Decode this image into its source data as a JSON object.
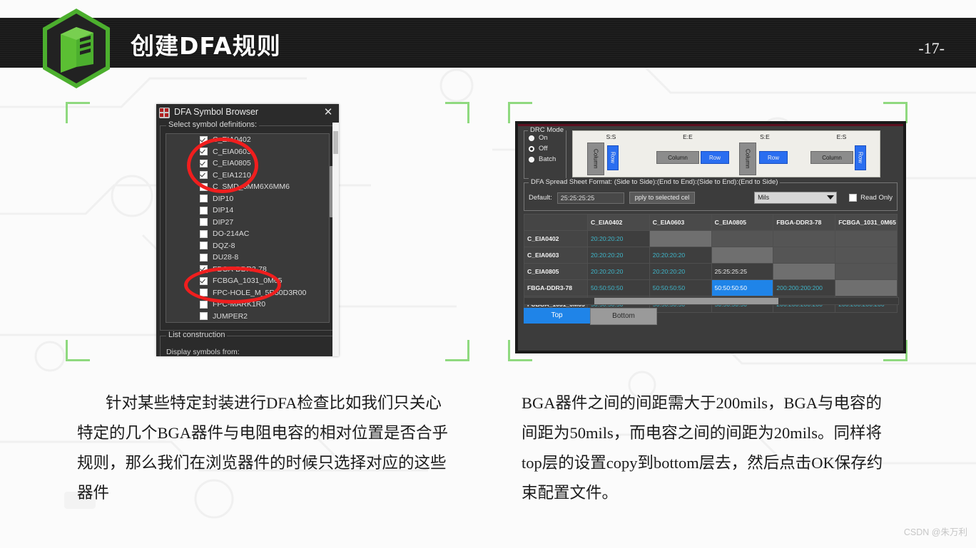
{
  "header": {
    "title": "创建DFA规则",
    "page_number": "-17-",
    "logo_icon": "cube-hexagon-logo",
    "band_color": "#191919",
    "accent_color": "#4CAF2E"
  },
  "bracket_color": "#8fd97f",
  "left_dialog": {
    "window_title": "DFA Symbol Browser",
    "app_icon": "dfa-symbol-icon",
    "close_icon": "close-icon",
    "group_label": "Select symbol definitions:",
    "symbols": [
      {
        "label": "C_EIA0402",
        "checked": true
      },
      {
        "label": "C_EIA0603",
        "checked": true
      },
      {
        "label": "C_EIA0805",
        "checked": true
      },
      {
        "label": "C_EIA1210",
        "checked": true
      },
      {
        "label": "C_SMD_6MM6X6MM6",
        "checked": false
      },
      {
        "label": "DIP10",
        "checked": false
      },
      {
        "label": "DIP14",
        "checked": false
      },
      {
        "label": "DIP27",
        "checked": false
      },
      {
        "label": "DO-214AC",
        "checked": false
      },
      {
        "label": "DQZ-8",
        "checked": false
      },
      {
        "label": "DU28-8",
        "checked": false
      },
      {
        "label": "FBGA-DDR3-78",
        "checked": true
      },
      {
        "label": "FCBGA_1031_0M65",
        "checked": true
      },
      {
        "label": "FPC-HOLE_M_5R50D3R00",
        "checked": false
      },
      {
        "label": "FPC-MARK1R0",
        "checked": false
      },
      {
        "label": "JUMPER2",
        "checked": false
      }
    ],
    "group2_label": "List construction",
    "group2_sub": "Display symbols from:"
  },
  "right_dialog": {
    "drc_mode": {
      "label": "DRC Mode",
      "options": [
        {
          "label": "On",
          "selected": false
        },
        {
          "label": "Off",
          "selected": true
        },
        {
          "label": "Batch",
          "selected": false
        }
      ]
    },
    "corner_panel": {
      "groups": [
        {
          "title": "S:S",
          "column_label": "Column",
          "row_label": "Row",
          "orientation": "col-vert-row-vert"
        },
        {
          "title": "E:E",
          "column_label": "Column",
          "row_label": "Row",
          "orientation": "col-horiz-row-horiz"
        },
        {
          "title": "S:E",
          "column_label": "Column",
          "row_label": "Row",
          "orientation": "col-vert-row-horiz"
        },
        {
          "title": "E:S",
          "column_label": "Column",
          "row_label": "Row",
          "orientation": "col-horiz-row-vert"
        }
      ]
    },
    "format_group": {
      "label": "DFA Spread Sheet Format: (Side to Side):(End to End):(Side to End):(End to Side)",
      "default_label": "Default:",
      "default_value": "25:25:25:25",
      "apply_button": "pply to selected cel",
      "units_value": "Mils",
      "units_icon": "chevron-down-icon",
      "read_only_label": "Read Only",
      "read_only_checked": false
    },
    "grid": {
      "columns": [
        "",
        "C_EIA0402",
        "C_EIA0603",
        "C_EIA0805",
        "FBGA-DDR3-78",
        "FCBGA_1031_0M65"
      ],
      "rows": [
        {
          "header": "C_EIA0402",
          "cells": [
            {
              "text": "20:20:20:20",
              "state": "value"
            },
            {
              "text": "",
              "state": "empty"
            },
            {
              "text": "",
              "state": "empty"
            },
            {
              "text": "",
              "state": "empty"
            },
            {
              "text": "",
              "state": "empty"
            }
          ]
        },
        {
          "header": "C_EIA0603",
          "cells": [
            {
              "text": "20:20:20:20",
              "state": "value"
            },
            {
              "text": "20:20:20:20",
              "state": "value"
            },
            {
              "text": "",
              "state": "empty"
            },
            {
              "text": "",
              "state": "empty"
            },
            {
              "text": "",
              "state": "empty"
            }
          ]
        },
        {
          "header": "C_EIA0805",
          "cells": [
            {
              "text": "20:20:20:20",
              "state": "value"
            },
            {
              "text": "20:20:20:20",
              "state": "value"
            },
            {
              "text": "25:25:25:25",
              "state": "value-white"
            },
            {
              "text": "",
              "state": "empty"
            },
            {
              "text": "",
              "state": "empty"
            }
          ]
        },
        {
          "header": "FBGA-DDR3-78",
          "cells": [
            {
              "text": "50:50:50:50",
              "state": "value"
            },
            {
              "text": "50:50:50:50",
              "state": "value"
            },
            {
              "text": "50:50:50:50",
              "state": "selected"
            },
            {
              "text": "200:200:200:200",
              "state": "value"
            },
            {
              "text": "",
              "state": "empty"
            }
          ]
        },
        {
          "header": "FCBGA_1031_0M65",
          "cells": [
            {
              "text": "50:50:50:50",
              "state": "value"
            },
            {
              "text": "50:50:50:50",
              "state": "value"
            },
            {
              "text": "50:50:50:50",
              "state": "value"
            },
            {
              "text": "200:200:200:200",
              "state": "value"
            },
            {
              "text": "200:200:200:200",
              "state": "value"
            }
          ]
        }
      ]
    },
    "tabs": [
      {
        "label": "Top",
        "active": true
      },
      {
        "label": "Bottom",
        "active": false
      }
    ],
    "selected_cell_color": "#1f84e8",
    "value_text_color": "#3fb5c9"
  },
  "body": {
    "paragraph_left": "针对某些特定封装进行DFA检查比如我们只关心特定的几个BGA器件与电阻电容的相对位置是否合乎规则，那么我们在浏览器件的时候只选择对应的这些器件",
    "paragraph_right": "BGA器件之间的间距需大于200mils，BGA与电容的间距为50mils，而电容之间的间距为20mils。同样将top层的设置copy到bottom层去，然后点击OK保存约束配置文件。"
  },
  "watermark": "CSDN @朱万利"
}
